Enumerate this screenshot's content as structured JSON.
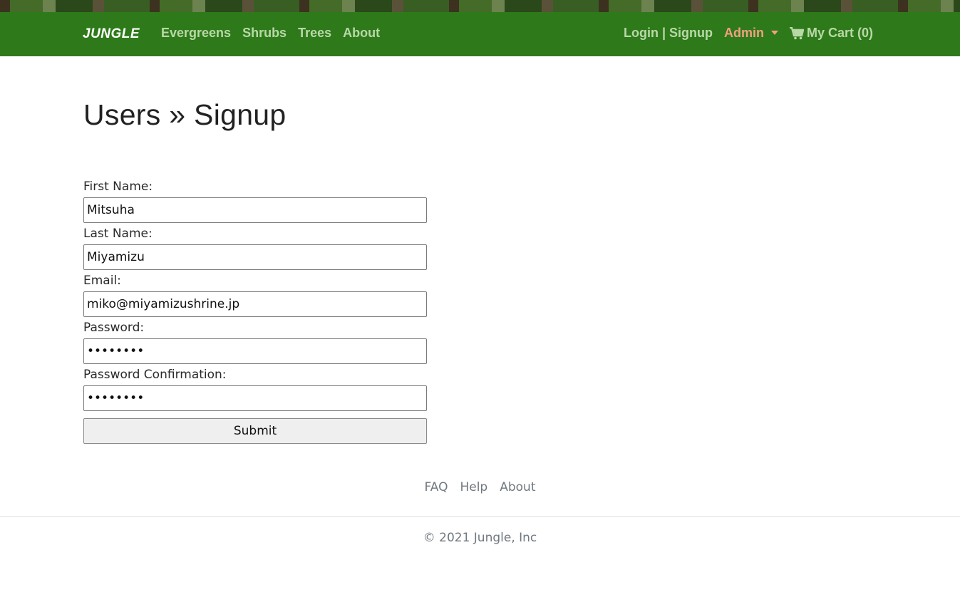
{
  "nav": {
    "brand": "JUNGLE",
    "left_links": [
      "Evergreens",
      "Shrubs",
      "Trees",
      "About"
    ],
    "login_signup": "Login | Signup",
    "admin": "Admin",
    "cart": "My Cart (0)",
    "cart_icon": "shopping-cart-icon"
  },
  "page": {
    "title": "Users » Signup"
  },
  "form": {
    "first_name_label": "First Name:",
    "first_name_value": "Mitsuha",
    "last_name_label": "Last Name:",
    "last_name_value": "Miyamizu",
    "email_label": "Email:",
    "email_value": "miko@miyamizushrine.jp",
    "password_label": "Password:",
    "password_value": "••••••••",
    "password_confirmation_label": "Password Confirmation:",
    "password_confirmation_value": "••••••••",
    "submit_label": "Submit"
  },
  "footer": {
    "links": [
      "FAQ",
      "Help",
      "About"
    ],
    "copyright": "© 2021 Jungle, Inc"
  },
  "colors": {
    "navbar": "#2e7a1a",
    "nav_link": "#b9d8a8",
    "admin_link": "#f0a080"
  }
}
